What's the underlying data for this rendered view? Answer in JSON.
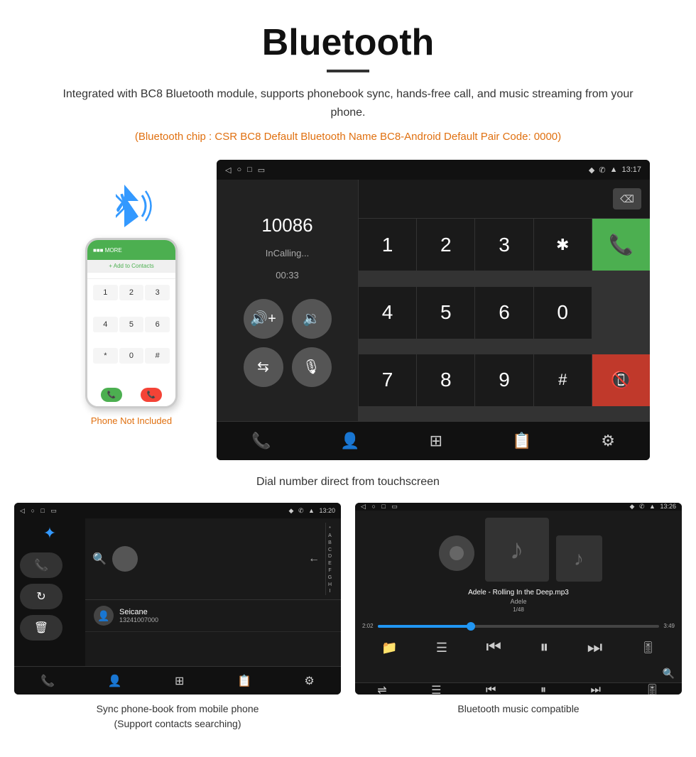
{
  "header": {
    "title": "Bluetooth",
    "subtitle": "Integrated with BC8 Bluetooth module, supports phonebook sync, hands-free call, and music streaming from your phone.",
    "orange_note": "(Bluetooth chip : CSR BC8    Default Bluetooth Name BC8-Android    Default Pair Code: 0000)"
  },
  "dial_screen": {
    "status_time": "13:17",
    "status_icons": "♦ ✆ ▲",
    "nav_left": "◁",
    "nav_home": "○",
    "nav_app": "□",
    "number": "10086",
    "in_calling": "InCalling...",
    "timer": "00:33",
    "keypad": [
      "1",
      "2",
      "3",
      "*",
      "4",
      "5",
      "6",
      "0",
      "7",
      "8",
      "9",
      "#"
    ],
    "call_icon": "📞",
    "end_icon": "📞"
  },
  "caption_dial": "Dial number direct from touchscreen",
  "contacts_screen": {
    "status_time": "13:20",
    "search_label": "🔍",
    "contact_name": "Seicane",
    "contact_number": "13241007000",
    "alphabet": [
      "*",
      "A",
      "B",
      "C",
      "D",
      "E",
      "F",
      "G",
      "H",
      "I"
    ]
  },
  "music_screen": {
    "status_time": "13:26",
    "song_title": "Adele - Rolling In the Deep.mp3",
    "artist": "Adele",
    "track_info": "1/48",
    "time_current": "2:02",
    "time_total": "3:49",
    "progress_percent": 33
  },
  "caption_contacts": "Sync phone-book from mobile phone\n(Support contacts searching)",
  "caption_music": "Bluetooth music compatible",
  "phone_not_included": "Phone Not Included"
}
